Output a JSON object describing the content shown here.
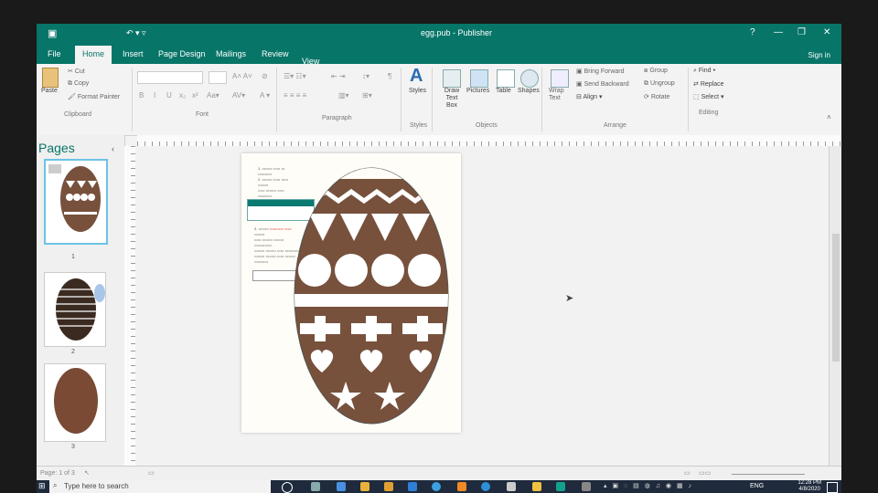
{
  "titlebar": {
    "doc_title": "egg.pub - Publisher",
    "help": "?",
    "minimize": "—",
    "restore": "❐",
    "close": "✕"
  },
  "tabs": [
    "File",
    "Home",
    "Insert",
    "Page Design",
    "Mailings",
    "Review",
    "View"
  ],
  "signin": "Sign in",
  "ribbon": {
    "clipboard": {
      "paste": "Paste",
      "cut": "Cut",
      "copy": "Copy",
      "format_painter": "Format Painter",
      "label": "Clipboard"
    },
    "font_label": "Font",
    "paragraph_label": "Paragraph",
    "styles": {
      "btn": "Styles",
      "label": "Styles"
    },
    "objects": {
      "draw_text_box": "Draw Text Box",
      "pictures": "Pictures",
      "table": "Table",
      "shapes": "Shapes",
      "label": "Objects"
    },
    "arrange": {
      "wrap_text": "Wrap Text",
      "bring_forward": "Bring Forward",
      "send_backward": "Send Backward",
      "align": "Align",
      "group": "Group",
      "ungroup": "Ungroup",
      "rotate": "Rotate",
      "label": "Arrange"
    },
    "editing": {
      "find": "Find",
      "replace": "Replace",
      "select": "Select",
      "label": "Editing"
    }
  },
  "pages_panel": {
    "title": "Pages",
    "page_numbers": [
      "1",
      "2",
      "3"
    ]
  },
  "status": {
    "page": "Page: 1 of 3"
  },
  "taskbar": {
    "search_placeholder": "Type here to search",
    "lang": "ENG",
    "time": "12:28 PM",
    "date": "4/8/2020"
  },
  "colors": {
    "brand": "#077568",
    "egg_brown": "#77513c",
    "egg_white": "#ffffff"
  }
}
